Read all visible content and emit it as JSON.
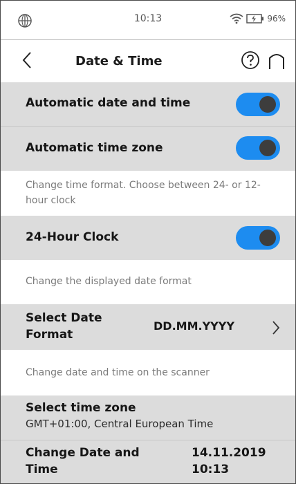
{
  "status_bar": {
    "time": "10:13",
    "battery": "96%"
  },
  "header": {
    "title": "Date & Time"
  },
  "settings": {
    "auto_date_time": {
      "label": "Automatic date and time",
      "enabled": true
    },
    "auto_time_zone": {
      "label": "Automatic time zone",
      "enabled": true
    },
    "time_format_desc": "Change time format. Choose between 24- or 12-hour clock",
    "clock_24h": {
      "label": "24-Hour Clock",
      "enabled": true
    },
    "date_format_desc": "Change the displayed date format",
    "select_date_format": {
      "label_line1": "Select Date",
      "label_line2": "Format",
      "value": "DD.MM.YYYY"
    },
    "date_time_desc": "Change date and time on the scanner",
    "select_time_zone": {
      "label": "Select time zone",
      "value": "GMT+01:00, Central European Time"
    },
    "change_date_time": {
      "label_line1": "Change Date and",
      "label_line2": "Time",
      "date": "14.11.2019",
      "time": "10:13"
    }
  },
  "colors": {
    "toggle_on": "#1d8cf0",
    "knob": "#3d3d3d",
    "row_gray": "#dcdcdc"
  }
}
